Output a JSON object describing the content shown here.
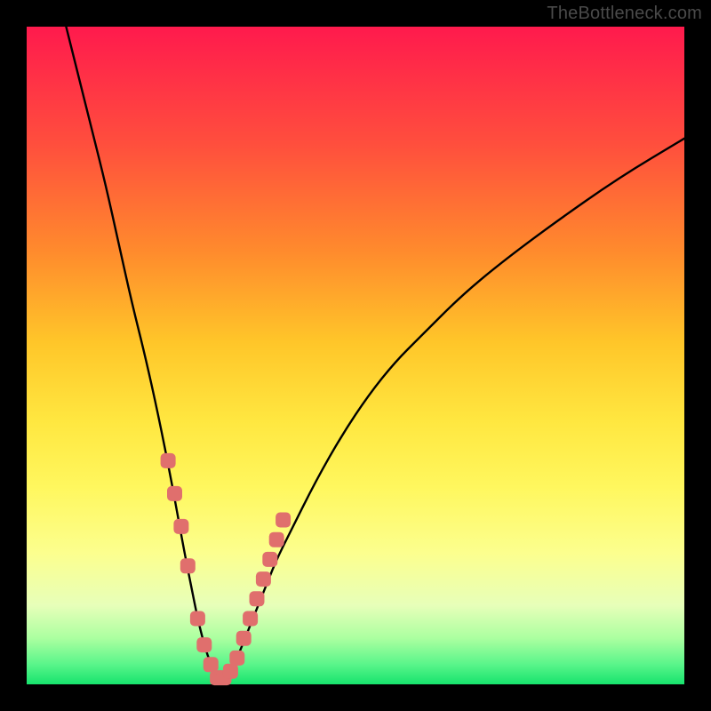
{
  "watermark": "TheBottleneck.com",
  "colors": {
    "curve": "#000000",
    "markers": "#e06f6d",
    "frame": "#000000"
  },
  "chart_data": {
    "type": "line",
    "title": "",
    "xlabel": "",
    "ylabel": "",
    "xlim": [
      0,
      100
    ],
    "ylim": [
      0,
      100
    ],
    "grid": false,
    "legend": false,
    "note": "Bottleneck-percentage style curve. Values estimated from pixels; minimum ~0 near x≈29.",
    "series": [
      {
        "name": "bottleneck-curve",
        "x": [
          6,
          8,
          10,
          12,
          14,
          16,
          18,
          20,
          22,
          24,
          25,
          26,
          27,
          28,
          29,
          30,
          31,
          32,
          34,
          36,
          38,
          40,
          44,
          48,
          52,
          56,
          60,
          66,
          72,
          80,
          90,
          100
        ],
        "y": [
          100,
          92,
          84,
          76,
          67,
          58,
          50,
          41,
          31,
          20,
          15,
          10,
          6,
          3,
          1,
          1,
          2,
          4,
          9,
          14,
          19,
          23,
          31,
          38,
          44,
          49,
          53,
          59,
          64,
          70,
          77,
          83
        ]
      }
    ],
    "markers": {
      "name": "highlighted-points",
      "x": [
        21.5,
        22.5,
        23.5,
        24.5,
        26.0,
        27.0,
        28.0,
        29.0,
        30.0,
        31.0,
        32.0,
        33.0,
        34.0,
        35.0,
        36.0,
        37.0,
        38.0,
        39.0
      ],
      "y": [
        34,
        29,
        24,
        18,
        10,
        6,
        3,
        1,
        1,
        2,
        4,
        7,
        10,
        13,
        16,
        19,
        22,
        25
      ]
    }
  }
}
